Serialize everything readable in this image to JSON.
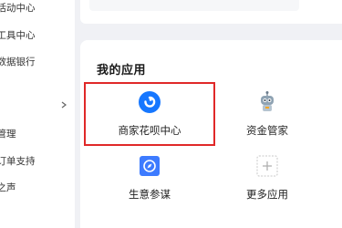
{
  "sidebar": {
    "items": [
      {
        "label": "销活动中心"
      },
      {
        "label": "销工具中心"
      },
      {
        "label": "牌数据银行"
      },
      {
        "label": "价管理"
      },
      {
        "label": "外订单支持"
      },
      {
        "label": "户之声"
      }
    ],
    "expand_icon": "chevron-right-icon"
  },
  "main": {
    "section_title": "我的应用",
    "apps": [
      {
        "label": "商家花呗中心",
        "icon": "huabei-icon",
        "color": "#1677ff",
        "highlighted": true
      },
      {
        "label": "资金管家",
        "icon": "robot-icon",
        "color": "#7a8b9a"
      },
      {
        "label": "生意参谋",
        "icon": "compass-icon",
        "color": "#3d7bff"
      },
      {
        "label": "更多应用",
        "icon": "plus-icon",
        "color": "#bbbbbb"
      }
    ]
  },
  "colors": {
    "highlight": "#e02828",
    "background": "#f0f1f5"
  }
}
